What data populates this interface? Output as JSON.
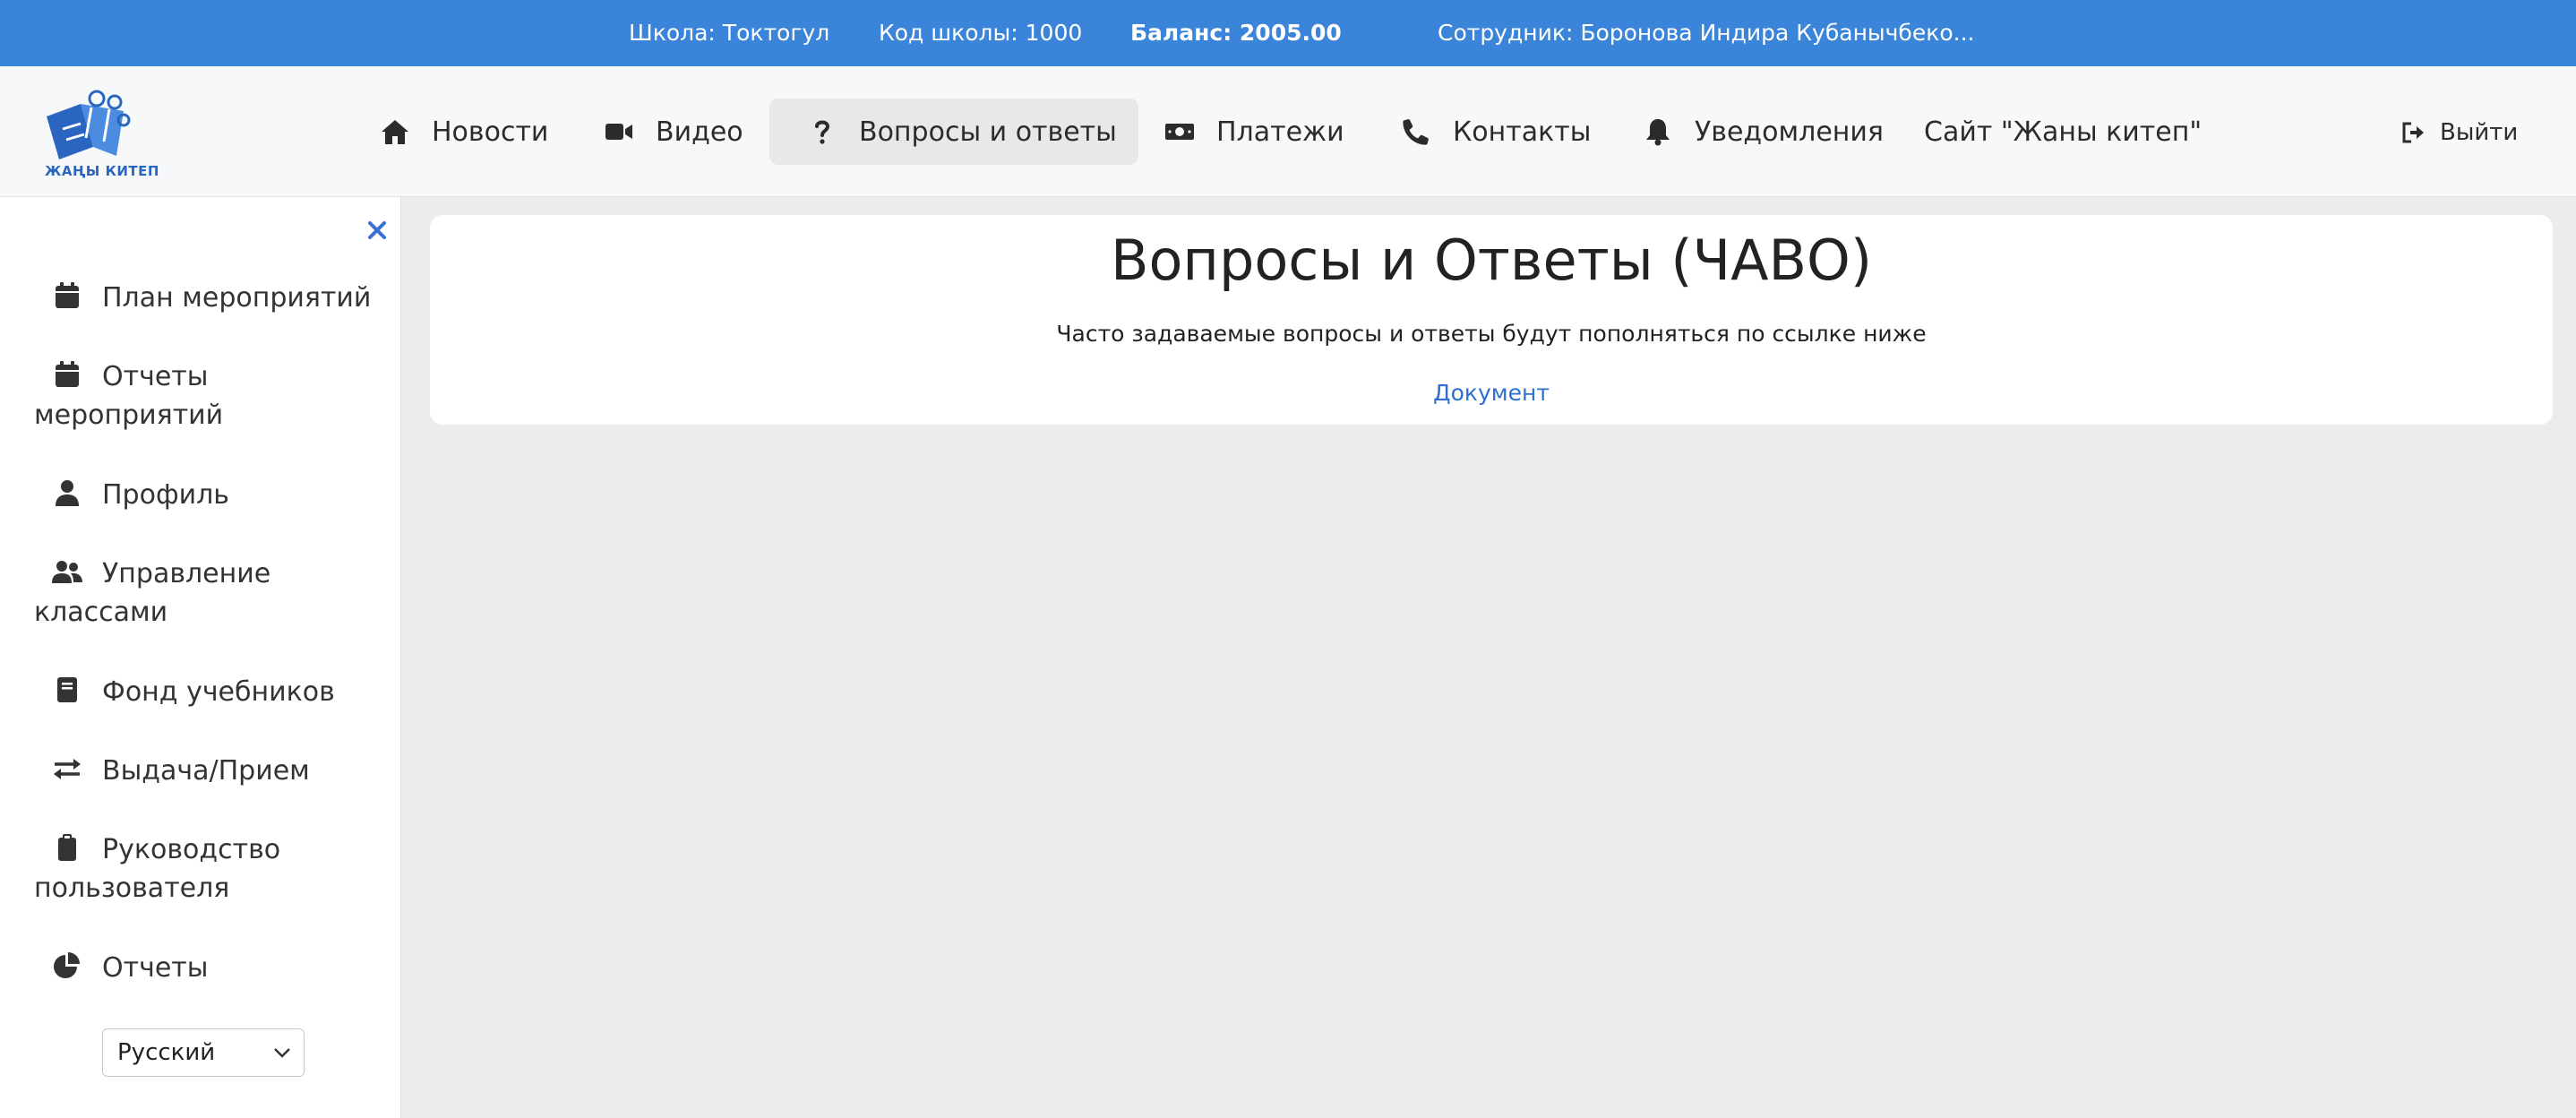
{
  "topbar": {
    "school": "Школа: Токтогул",
    "school_code": "Код школы: 1000",
    "balance": "Баланс: 2005.00",
    "employee": "Сотрудник: Боронова Индира Кубанычбеко..."
  },
  "logo": {
    "text": "ЖАҢЫ КИТЕП"
  },
  "nav": {
    "items": [
      {
        "label": "Новости",
        "icon": "home-icon"
      },
      {
        "label": "Видео",
        "icon": "video-icon"
      },
      {
        "label": "Вопросы и ответы",
        "icon": "question-icon"
      },
      {
        "label": "Платежи",
        "icon": "money-icon"
      },
      {
        "label": "Контакты",
        "icon": "phone-icon"
      },
      {
        "label": "Уведомления",
        "icon": "bell-icon"
      },
      {
        "label": "Сайт \"Жаны китеп\""
      }
    ],
    "active": "Вопросы и ответы",
    "logout_label": "Выйти"
  },
  "sidebar": {
    "items": [
      {
        "label": "План мероприятий",
        "icon": "calendar-icon"
      },
      {
        "label": "Отчеты мероприятий",
        "icon": "calendar-icon"
      },
      {
        "label": "Профиль",
        "icon": "user-icon"
      },
      {
        "label": "Управление классами",
        "icon": "users-icon"
      },
      {
        "label": "Фонд учебников",
        "icon": "book-icon"
      },
      {
        "label": "Выдача/Прием",
        "icon": "exchange-icon"
      },
      {
        "label": "Руководство пользователя",
        "icon": "clipboard-icon"
      },
      {
        "label": "Отчеты",
        "icon": "pie-chart-icon"
      }
    ],
    "language": "Русский"
  },
  "main": {
    "title": "Вопросы и Ответы (ЧАВО)",
    "subtitle": "Часто задаваемые вопросы и ответы будут пополняться по ссылке ниже",
    "link_label": "Документ"
  },
  "colors": {
    "topbar": "#3a84d9",
    "link": "#2f6fd0",
    "close": "#3a6fd6",
    "logo": "#2a66c0"
  }
}
